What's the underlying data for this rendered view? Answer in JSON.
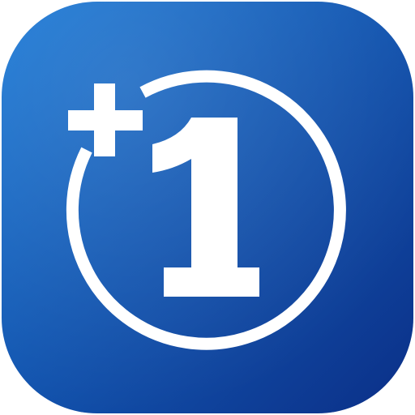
{
  "app_icon": {
    "icon": "plus-one-icon",
    "plus_sign": "+",
    "numeral": "1",
    "colors": {
      "background_top_left": "#1a79d6",
      "background_bottom_right": "#0b2f87",
      "foreground": "#ffffff"
    }
  }
}
